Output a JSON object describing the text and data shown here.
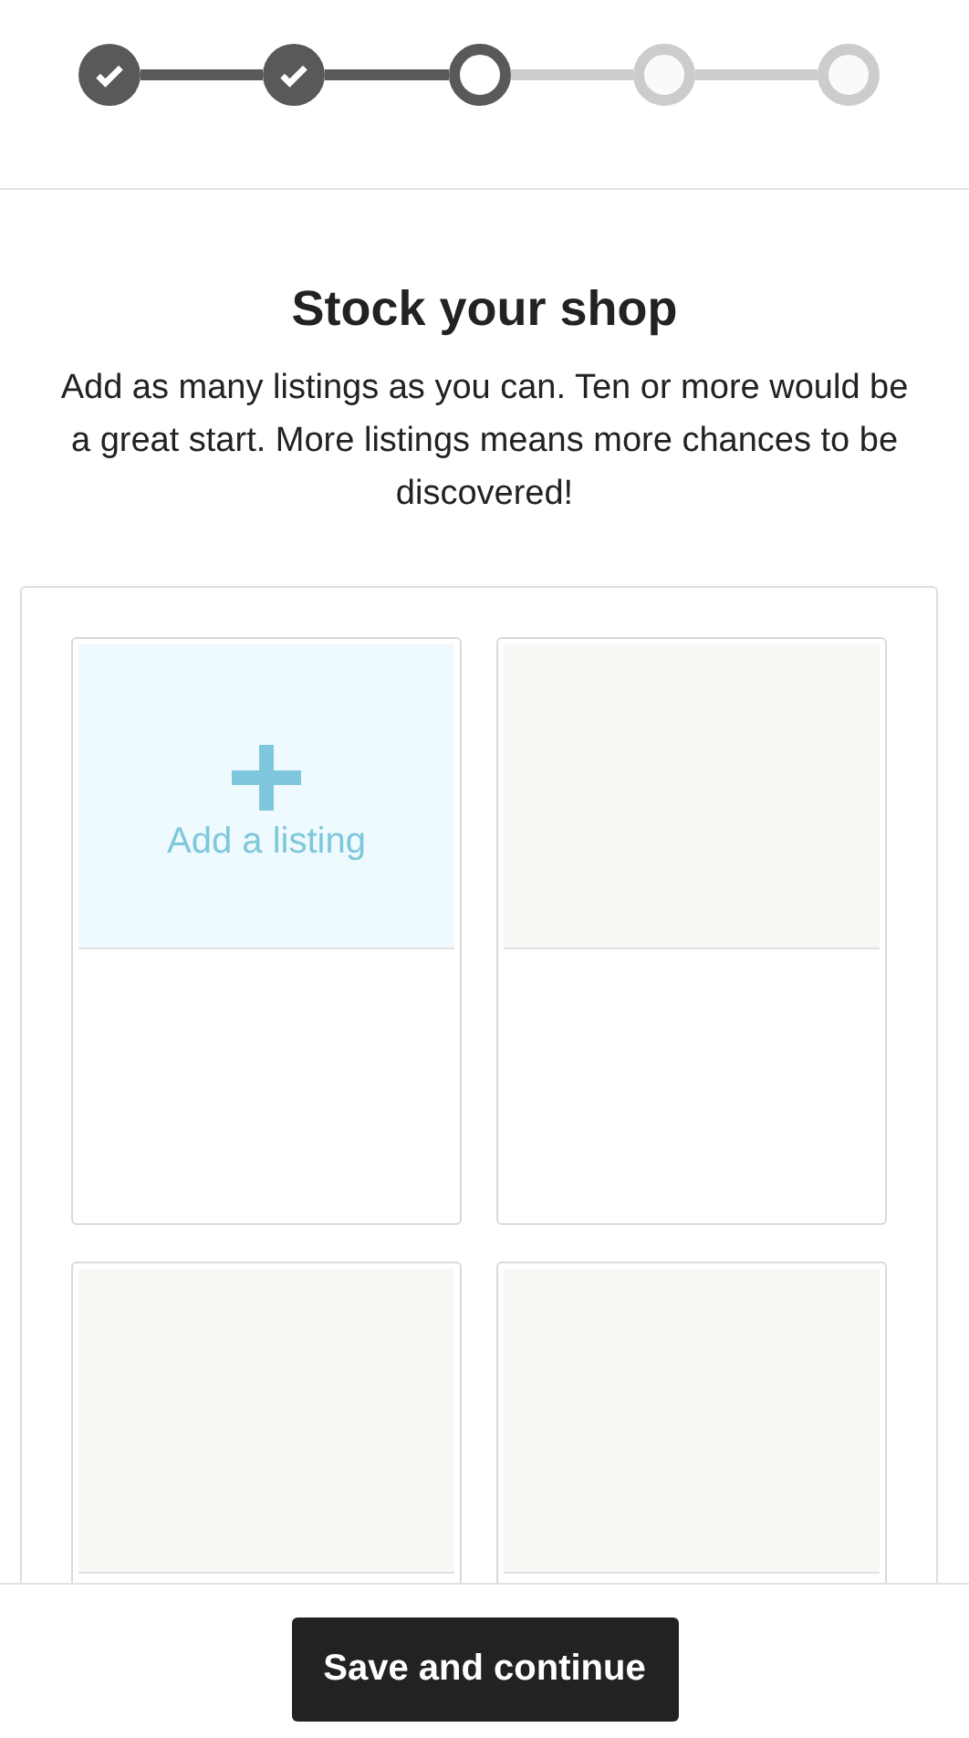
{
  "steps": [
    {
      "kind": "done"
    },
    {
      "kind": "done"
    },
    {
      "kind": "current"
    },
    {
      "kind": "todo"
    },
    {
      "kind": "todo"
    }
  ],
  "heading": "Stock your shop",
  "description": "Add as many listings as you can. Ten or more would be a great start. More listings means more chances to be discovered!",
  "listings": [
    {
      "kind": "add",
      "label": "Add a listing"
    },
    {
      "kind": "empty"
    },
    {
      "kind": "empty"
    },
    {
      "kind": "empty"
    }
  ],
  "footer": {
    "button": "Save and continue"
  }
}
